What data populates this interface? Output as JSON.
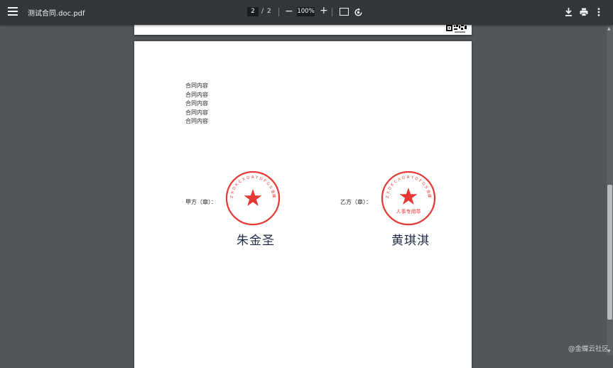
{
  "toolbar": {
    "title": "测试合同.doc.pdf",
    "current_page": "2",
    "page_separator": "/",
    "total_pages": "2",
    "zoom": "100%",
    "zoom_out_symbol": "−",
    "zoom_in_symbol": "+"
  },
  "document": {
    "content_lines": [
      "合同内容",
      "合同内容",
      "合同内容",
      "合同内容",
      "合同内容"
    ],
    "party_a": {
      "label": "甲方（章）：",
      "seal_text": "Z X D K C X G A Y D F G S 金蝶软件（中国）有限公司",
      "signature": "朱金圣"
    },
    "party_b": {
      "label": "乙方（章）：",
      "seal_text": "Z X D K C X G A Y D F G S 金蝶软件（中国）有限公司",
      "seal_center": "人事专用章",
      "signature": "黄琪淇"
    }
  },
  "watermark": "@金蝶云社区",
  "colors": {
    "toolbar_bg": "#323639",
    "viewer_bg": "#525659",
    "seal_red": "#e53935"
  }
}
